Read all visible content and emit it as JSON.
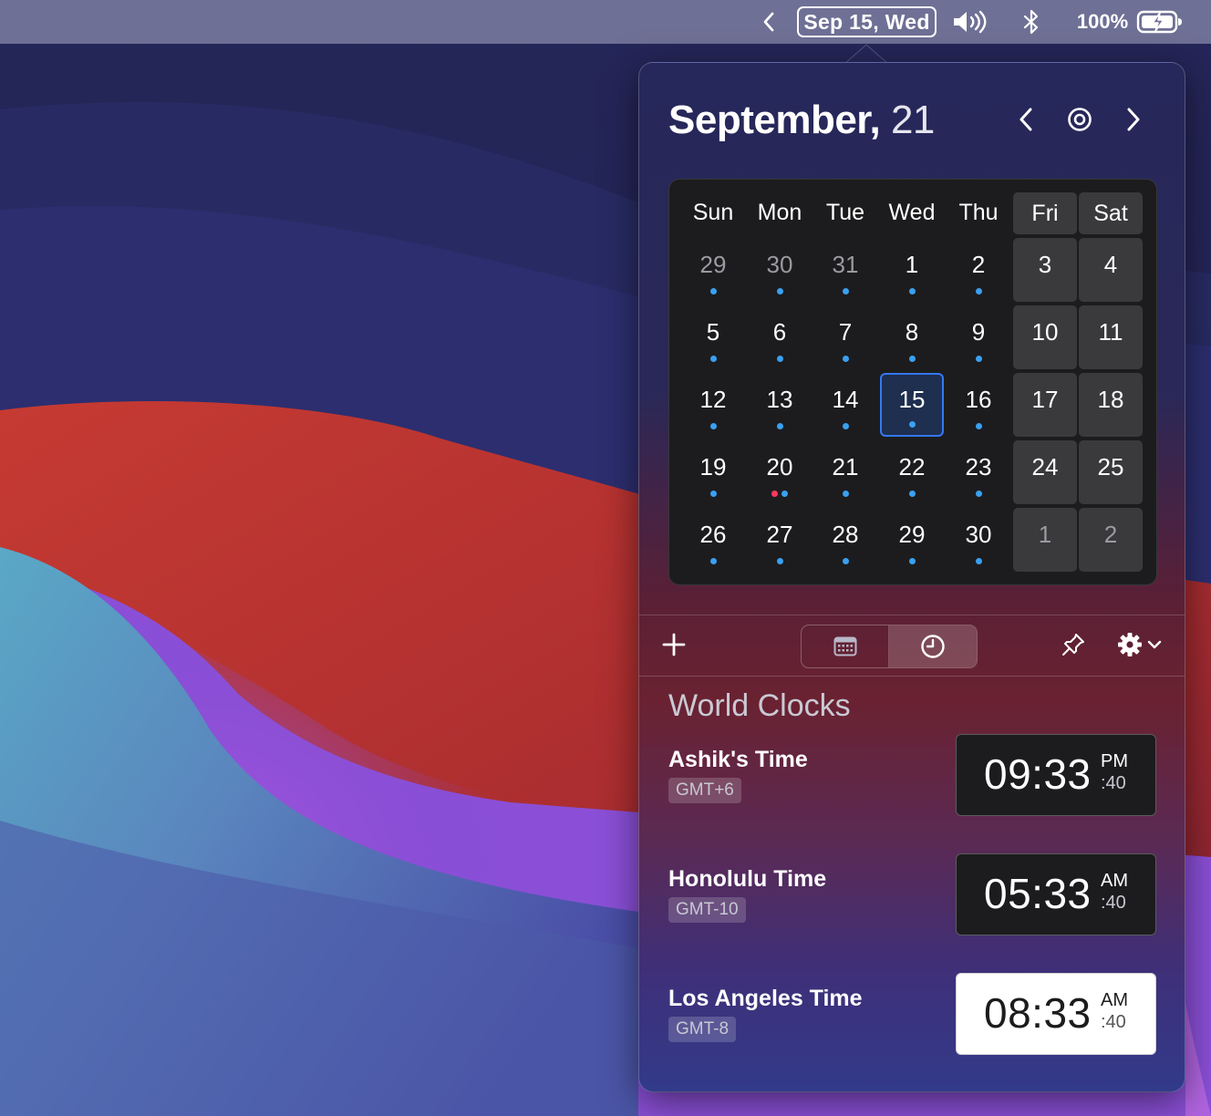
{
  "menubar": {
    "date_label": "Sep 15, Wed",
    "battery_text": "100%",
    "icons": [
      "chevron-left-icon",
      "volume-icon",
      "bluetooth-icon",
      "battery-charging-icon"
    ]
  },
  "calendar": {
    "month": "September,",
    "year": "21",
    "weekdays": [
      "Sun",
      "Mon",
      "Tue",
      "Wed",
      "Thu",
      "Fri",
      "Sat"
    ],
    "weeks": [
      [
        {
          "d": "29",
          "other": true,
          "dots": [
            "blue"
          ]
        },
        {
          "d": "30",
          "other": true,
          "dots": [
            "blue"
          ]
        },
        {
          "d": "31",
          "other": true,
          "dots": [
            "blue"
          ]
        },
        {
          "d": "1",
          "dots": [
            "blue"
          ]
        },
        {
          "d": "2",
          "dots": [
            "blue"
          ]
        },
        {
          "d": "3",
          "dots": []
        },
        {
          "d": "4",
          "dots": []
        }
      ],
      [
        {
          "d": "5",
          "dots": [
            "blue"
          ]
        },
        {
          "d": "6",
          "dots": [
            "blue"
          ]
        },
        {
          "d": "7",
          "dots": [
            "blue"
          ]
        },
        {
          "d": "8",
          "dots": [
            "blue"
          ]
        },
        {
          "d": "9",
          "dots": [
            "blue"
          ]
        },
        {
          "d": "10",
          "dots": []
        },
        {
          "d": "11",
          "dots": []
        }
      ],
      [
        {
          "d": "12",
          "dots": [
            "blue"
          ]
        },
        {
          "d": "13",
          "dots": [
            "blue"
          ]
        },
        {
          "d": "14",
          "dots": [
            "blue"
          ]
        },
        {
          "d": "15",
          "today": true,
          "dots": [
            "blue"
          ]
        },
        {
          "d": "16",
          "dots": [
            "blue"
          ]
        },
        {
          "d": "17",
          "dots": []
        },
        {
          "d": "18",
          "dots": []
        }
      ],
      [
        {
          "d": "19",
          "dots": [
            "blue"
          ]
        },
        {
          "d": "20",
          "dots": [
            "red",
            "blue"
          ]
        },
        {
          "d": "21",
          "dots": [
            "blue"
          ]
        },
        {
          "d": "22",
          "dots": [
            "blue"
          ]
        },
        {
          "d": "23",
          "dots": [
            "blue"
          ]
        },
        {
          "d": "24",
          "dots": []
        },
        {
          "d": "25",
          "dots": []
        }
      ],
      [
        {
          "d": "26",
          "dots": [
            "blue"
          ]
        },
        {
          "d": "27",
          "dots": [
            "blue"
          ]
        },
        {
          "d": "28",
          "dots": [
            "blue"
          ]
        },
        {
          "d": "29",
          "dots": [
            "blue"
          ]
        },
        {
          "d": "30",
          "dots": [
            "blue"
          ]
        },
        {
          "d": "1",
          "other": true,
          "dots": []
        },
        {
          "d": "2",
          "other": true,
          "dots": []
        }
      ]
    ],
    "colors": {
      "today_border": "#3478f6",
      "event_dot_blue": "#3aa0f0",
      "event_dot_red": "#ff375f",
      "weekend_cell": "#3a3a3c"
    }
  },
  "toolbar": {
    "add_icon": "plus-icon",
    "view_modes": [
      "calendar-icon",
      "clock-icon"
    ],
    "active_view": "clock-icon",
    "pin_icon": "pin-icon",
    "settings_icon": "gear-icon"
  },
  "world_clocks": {
    "title": "World Clocks",
    "clocks": [
      {
        "name": "Ashik's Time",
        "tz": "GMT+6",
        "time": "09:33",
        "ampm": "PM",
        "seconds": ":40",
        "style": "dark"
      },
      {
        "name": "Honolulu Time",
        "tz": "GMT-10",
        "time": "05:33",
        "ampm": "AM",
        "seconds": ":40",
        "style": "dark"
      },
      {
        "name": "Los Angeles Time",
        "tz": "GMT-8",
        "time": "08:33",
        "ampm": "AM",
        "seconds": ":40",
        "style": "light"
      }
    ]
  }
}
